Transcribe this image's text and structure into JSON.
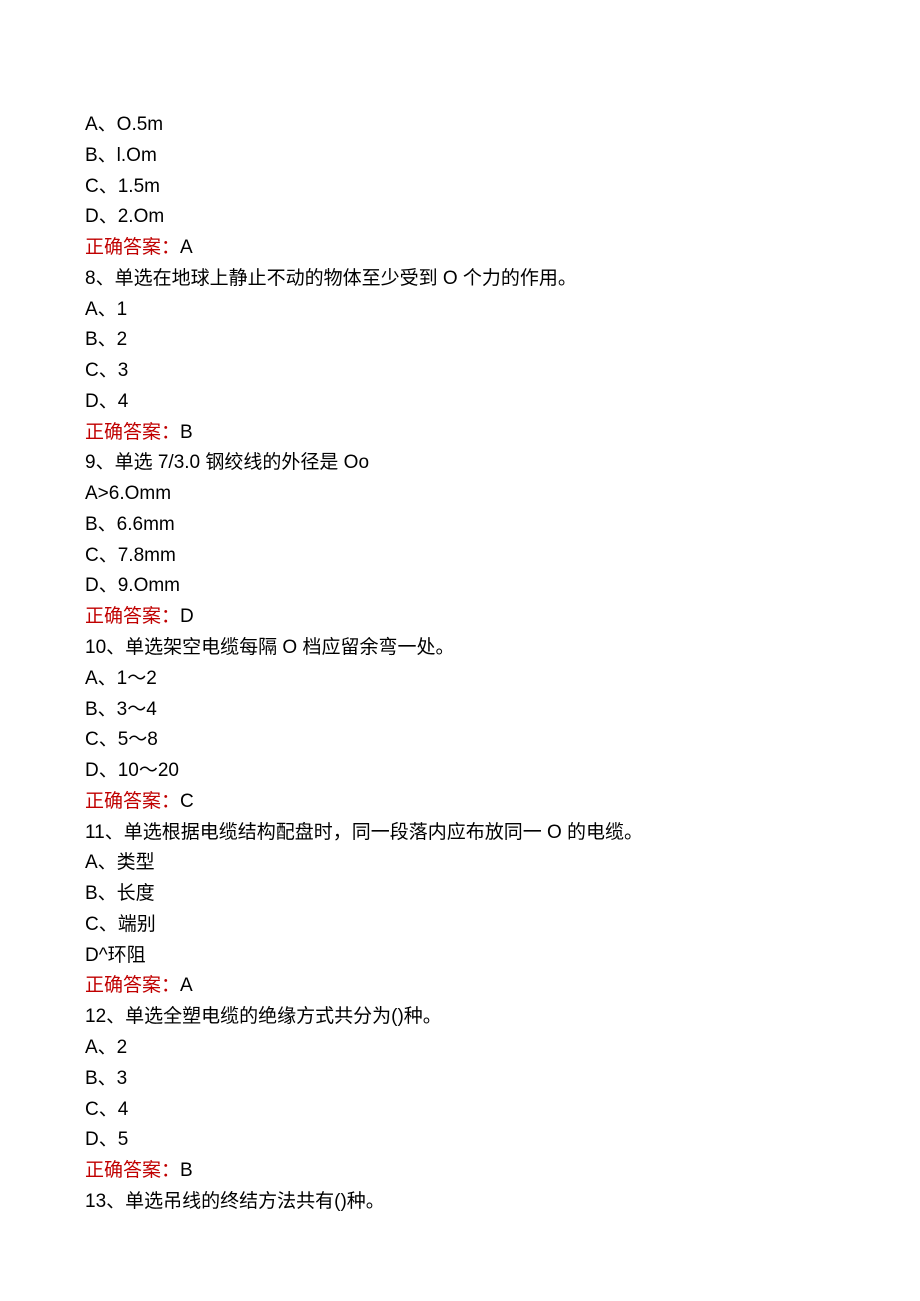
{
  "questions": [
    {
      "options": [
        {
          "text": "A、O.5m"
        },
        {
          "text": "B、l.Om"
        },
        {
          "text": "C、1.5m"
        },
        {
          "text": "D、2.Om"
        }
      ],
      "answer_label": "正确答案：",
      "answer_value": "A"
    },
    {
      "stem": "8、单选在地球上静止不动的物体至少受到 O 个力的作用。",
      "options": [
        {
          "text": "A、1"
        },
        {
          "text": "B、2"
        },
        {
          "text": "C、3"
        },
        {
          "text": "D、4"
        }
      ],
      "answer_label": "正确答案：",
      "answer_value": "B"
    },
    {
      "stem": "9、单选 7/3.0 钢绞线的外径是 Oo",
      "options": [
        {
          "text": "A>6.Omm"
        },
        {
          "text": "B、6.6mm"
        },
        {
          "text": "C、7.8mm"
        },
        {
          "text": "D、9.Omm"
        }
      ],
      "answer_label": "正确答案：",
      "answer_value": "D"
    },
    {
      "stem": "10、单选架空电缆每隔 O 档应留余弯一处。",
      "options": [
        {
          "text": "A、1〜2"
        },
        {
          "text": "B、3〜4"
        },
        {
          "text": "C、5〜8"
        },
        {
          "text": "D、10〜20"
        }
      ],
      "answer_label": "正确答案：",
      "answer_value": "C"
    },
    {
      "stem": "11、单选根据电缆结构配盘时，同一段落内应布放同一 O 的电缆。",
      "options": [
        {
          "text": "A、类型"
        },
        {
          "text": "B、长度"
        },
        {
          "text": "C、端别"
        },
        {
          "text": "D^环阻"
        }
      ],
      "answer_label": "正确答案：",
      "answer_value": "A"
    },
    {
      "stem": "12、单选全塑电缆的绝缘方式共分为()种。",
      "options": [
        {
          "text": "A、2"
        },
        {
          "text": "B、3"
        },
        {
          "text": "C、4"
        },
        {
          "text": "D、5"
        }
      ],
      "answer_label": "正确答案：",
      "answer_value": "B"
    },
    {
      "stem": "13、单选吊线的终结方法共有()种。"
    }
  ]
}
